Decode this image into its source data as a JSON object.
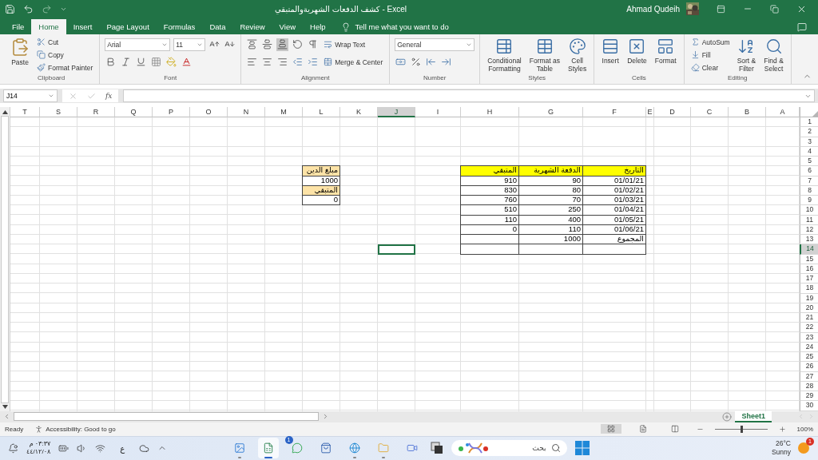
{
  "title_bar": {
    "title": "كشف الدفعات الشهريةوالمتبقي - Excel",
    "user": "Ahmad Qudeih"
  },
  "tabs": [
    {
      "label": "File",
      "selected": false
    },
    {
      "label": "Home",
      "selected": true
    },
    {
      "label": "Insert",
      "selected": false
    },
    {
      "label": "Page Layout",
      "selected": false
    },
    {
      "label": "Formulas",
      "selected": false
    },
    {
      "label": "Data",
      "selected": false
    },
    {
      "label": "Review",
      "selected": false
    },
    {
      "label": "View",
      "selected": false
    },
    {
      "label": "Help",
      "selected": false
    }
  ],
  "tell_me": {
    "placeholder": "Tell me what you want to do"
  },
  "ribbon": {
    "groups": [
      {
        "label": "Clipboard",
        "kind": "clipboard",
        "big": "Paste",
        "items": [
          "Cut",
          "Copy",
          "Format Painter"
        ]
      },
      {
        "label": "Font",
        "kind": "font",
        "font": "Arial",
        "size": "11"
      },
      {
        "label": "Alignment",
        "kind": "alignment",
        "items": [
          "Wrap Text",
          "Merge & Center"
        ]
      },
      {
        "label": "Number",
        "kind": "number",
        "format": "General"
      },
      {
        "label": "Styles",
        "kind": "styles",
        "items": [
          "Conditional\nFormatting",
          "Format as\nTable",
          "Cell\nStyles"
        ]
      },
      {
        "label": "Cells",
        "kind": "cells",
        "items": [
          "Insert",
          "Delete",
          "Format"
        ]
      },
      {
        "label": "Editing",
        "kind": "editing",
        "items": [
          "AutoSum",
          "Fill",
          "Clear"
        ],
        "large": [
          "Sort &\nFilter",
          "Find &\nSelect"
        ]
      }
    ]
  },
  "formula_bar": {
    "name_box": "J14",
    "function_label": "fx"
  },
  "columns": [
    {
      "label": "T",
      "selected": false
    },
    {
      "label": "S",
      "selected": false
    },
    {
      "label": "R",
      "selected": false
    },
    {
      "label": "Q",
      "selected": false
    },
    {
      "label": "P",
      "selected": false
    },
    {
      "label": "O",
      "selected": false
    },
    {
      "label": "N",
      "selected": false
    },
    {
      "label": "M",
      "selected": false
    },
    {
      "label": "L",
      "selected": false
    },
    {
      "label": "K",
      "selected": false
    },
    {
      "label": "J",
      "selected": true
    },
    {
      "label": "I",
      "selected": false
    },
    {
      "label": "H",
      "selected": false
    },
    {
      "label": "G",
      "selected": false
    },
    {
      "label": "F",
      "selected": false
    },
    {
      "label": "E",
      "selected": false
    },
    {
      "label": "D",
      "selected": false
    },
    {
      "label": "C",
      "selected": false
    },
    {
      "label": "B",
      "selected": false
    },
    {
      "label": "A",
      "selected": false
    }
  ],
  "rows": [
    {
      "label": "1",
      "selected": false
    },
    {
      "label": "2",
      "selected": false
    },
    {
      "label": "3",
      "selected": false
    },
    {
      "label": "4",
      "selected": false
    },
    {
      "label": "5",
      "selected": false
    },
    {
      "label": "6",
      "selected": false
    },
    {
      "label": "7",
      "selected": false
    },
    {
      "label": "8",
      "selected": false
    },
    {
      "label": "9",
      "selected": false
    },
    {
      "label": "10",
      "selected": false
    },
    {
      "label": "11",
      "selected": false
    },
    {
      "label": "12",
      "selected": false
    },
    {
      "label": "13",
      "selected": false
    },
    {
      "label": "14",
      "selected": true
    },
    {
      "label": "15",
      "selected": false
    },
    {
      "label": "16",
      "selected": false
    },
    {
      "label": "17",
      "selected": false
    },
    {
      "label": "18",
      "selected": false
    },
    {
      "label": "19",
      "selected": false
    },
    {
      "label": "20",
      "selected": false
    },
    {
      "label": "21",
      "selected": false
    },
    {
      "label": "22",
      "selected": false
    },
    {
      "label": "23",
      "selected": false
    },
    {
      "label": "24",
      "selected": false
    },
    {
      "label": "25",
      "selected": false
    },
    {
      "label": "26",
      "selected": false
    },
    {
      "label": "27",
      "selected": false
    },
    {
      "label": "28",
      "selected": false
    },
    {
      "label": "29",
      "selected": false
    },
    {
      "label": "30",
      "selected": false
    }
  ],
  "debt_box": {
    "amount_label": "مبلغ الدين",
    "amount": "1000",
    "remaining_label": "المتبقي",
    "remaining": "0"
  },
  "payments_table": {
    "headers": {
      "date": "التاريخ",
      "payment": "الدفعة الشهرية",
      "balance": "المتبقي"
    },
    "rows": [
      {
        "date": "01/01/21",
        "payment": "90",
        "balance": "910"
      },
      {
        "date": "01/02/21",
        "payment": "80",
        "balance": "830"
      },
      {
        "date": "01/03/21",
        "payment": "70",
        "balance": "760"
      },
      {
        "date": "01/04/21",
        "payment": "250",
        "balance": "510"
      },
      {
        "date": "01/05/21",
        "payment": "400",
        "balance": "110"
      },
      {
        "date": "01/06/21",
        "payment": "110",
        "balance": "0"
      }
    ],
    "total": {
      "label": "المجموع",
      "payment": "1000"
    }
  },
  "sheet_tabs": [
    {
      "label": "Sheet1",
      "selected": true
    }
  ],
  "status_bar": {
    "status": "Ready",
    "accessibility": "Accessibility: Good to go",
    "zoom": {
      "level": 0.5,
      "reading": "100%"
    }
  },
  "taskbar": {
    "clock": {
      "time": "٠٣:٣٧ م",
      "date": "٤٤/١٢/٠٨"
    },
    "language": "ع",
    "apps": [
      {
        "kind": "photos",
        "selected": false,
        "running": true
      },
      {
        "kind": "excel",
        "selected": true,
        "running": true
      },
      {
        "kind": "whatsapp",
        "selected": false,
        "running": false,
        "badge": "1"
      },
      {
        "kind": "store",
        "selected": false,
        "running": false
      },
      {
        "kind": "edge",
        "selected": false,
        "running": true
      },
      {
        "kind": "files",
        "selected": false,
        "running": true
      },
      {
        "kind": "meet",
        "selected": false,
        "running": false
      }
    ],
    "search": {
      "placeholder": "بحث"
    },
    "weather": {
      "temperature": "26°C",
      "condition": "Sunny",
      "badge": "1"
    }
  }
}
